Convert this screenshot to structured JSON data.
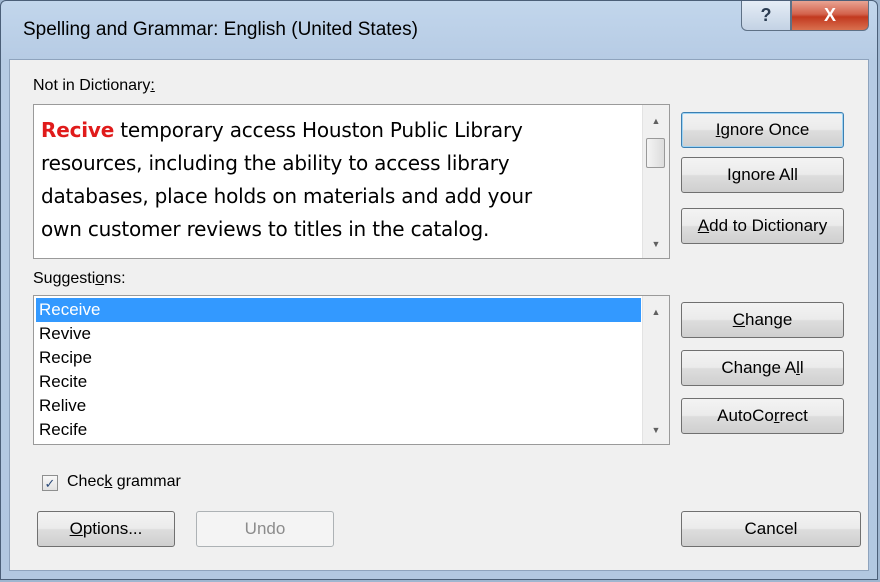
{
  "window": {
    "title": "Spelling and Grammar: English (United States)",
    "help_label": "?",
    "close_label": "X"
  },
  "not_in_dictionary": {
    "label_text": "Not in Dictionary",
    "label_mnemonic": ":",
    "error_word": "Recive",
    "lines": [
      " temporary access  Houston Public Library",
      "resources, including the ability to access library",
      "databases, place holds on materials and add your",
      "own customer reviews to titles in  the catalog."
    ]
  },
  "suggestions": {
    "label_before": "Suggesti",
    "label_mnemonic": "o",
    "label_after": "ns:",
    "items": [
      "Receive",
      "Revive",
      "Recipe",
      "Recite",
      "Relive",
      "Recife"
    ],
    "selected_index": 0
  },
  "check_grammar": {
    "label_before": "Chec",
    "label_mnemonic": "k",
    "label_after": " grammar",
    "checked": true
  },
  "buttons": {
    "ignore_once": {
      "before": "",
      "mnemonic": "I",
      "after": "gnore Once"
    },
    "ignore_all": {
      "before": "I",
      "mnemonic": "g",
      "after": "nore All"
    },
    "add_to_dictionary": {
      "before": "",
      "mnemonic": "A",
      "after": "dd to Dictionary"
    },
    "change": {
      "before": "",
      "mnemonic": "C",
      "after": "hange"
    },
    "change_all": {
      "before": "Change A",
      "mnemonic": "l",
      "after": "l"
    },
    "autocorrect": {
      "before": "AutoCo",
      "mnemonic": "r",
      "after": "rect"
    },
    "options": {
      "before": "",
      "mnemonic": "O",
      "after": "ptions..."
    },
    "undo": {
      "before": "Undo",
      "mnemonic": "",
      "after": ""
    },
    "cancel": {
      "before": "Cancel",
      "mnemonic": "",
      "after": ""
    }
  },
  "icons": {
    "scroll_up": "▲",
    "scroll_down": "▼",
    "check": "✓"
  },
  "colors": {
    "error_text": "#e01b1b",
    "selection": "#3399ff",
    "close_button": "#c2391f"
  }
}
